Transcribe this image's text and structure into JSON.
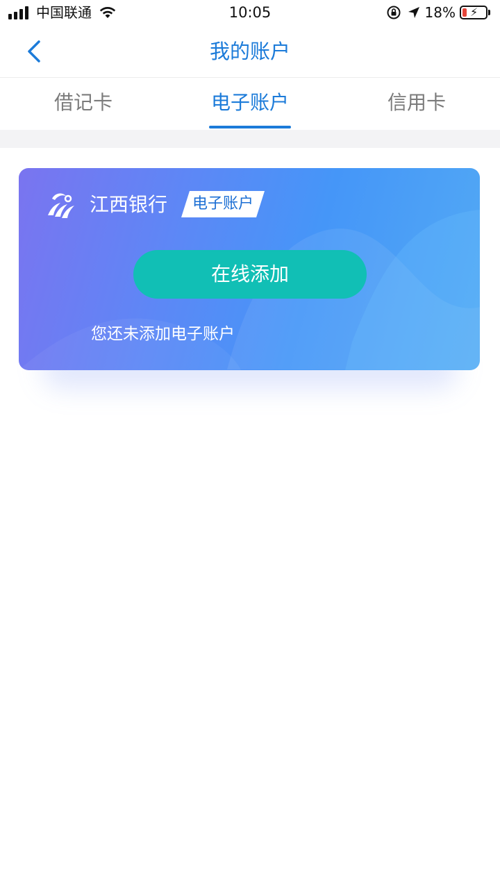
{
  "status_bar": {
    "carrier": "中国联通",
    "time": "10:05",
    "battery_percent": "18%",
    "battery_level": 0.18,
    "icons": [
      "signal-icon",
      "wifi-icon",
      "rotation-lock-icon",
      "location-icon",
      "battery-charging-icon"
    ]
  },
  "header": {
    "title": "我的账户",
    "back_icon": "chevron-left-icon"
  },
  "tabs": [
    {
      "label": "借记卡",
      "active": false
    },
    {
      "label": "电子账户",
      "active": true
    },
    {
      "label": "信用卡",
      "active": false
    }
  ],
  "card": {
    "bank_name": "江西银行",
    "badge": "电子账户",
    "add_button": "在线添加",
    "empty_message": "您还未添加电子账户",
    "logo_icon": "bank-logo-icon"
  },
  "colors": {
    "accent": "#1c7bd9",
    "button": "#11bfb5",
    "card_gradient_start": "#7a74f0",
    "card_gradient_end": "#53aaf4"
  }
}
